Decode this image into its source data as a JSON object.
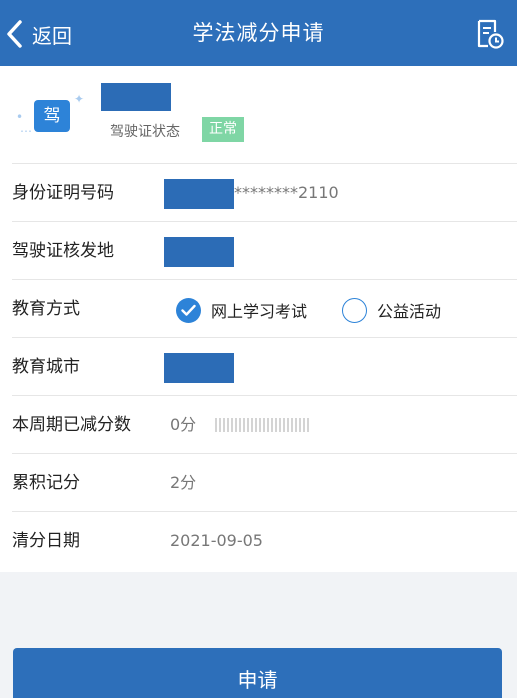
{
  "nav": {
    "back_label": "返回",
    "title": "学法减分申请",
    "doc_icon": "document-clock-icon",
    "back_icon": "chevron-left-icon"
  },
  "license": {
    "icon_text": "驾",
    "status_label": "驾驶证状态",
    "status": "正常"
  },
  "fields": {
    "id_number": {
      "label": "身份证明号码",
      "value": "********2110"
    },
    "issuing_place": {
      "label": "驾驶证核发地"
    },
    "education_method": {
      "label": "教育方式",
      "options": [
        "网上学习考试",
        "公益活动"
      ],
      "selected": "网上学习考试"
    },
    "education_city": {
      "label": "教育城市"
    },
    "period_reduced": {
      "label": "本周期已减分数",
      "value": "0分"
    },
    "accumulated": {
      "label": "累积记分",
      "value": "2分"
    },
    "clear_date": {
      "label": "清分日期",
      "value": "2021-09-05"
    }
  },
  "submit_label": "申请",
  "colors": {
    "primary": "#2d6fba",
    "accent": "#2d83d8",
    "status_ok": "#7fd6a5"
  }
}
